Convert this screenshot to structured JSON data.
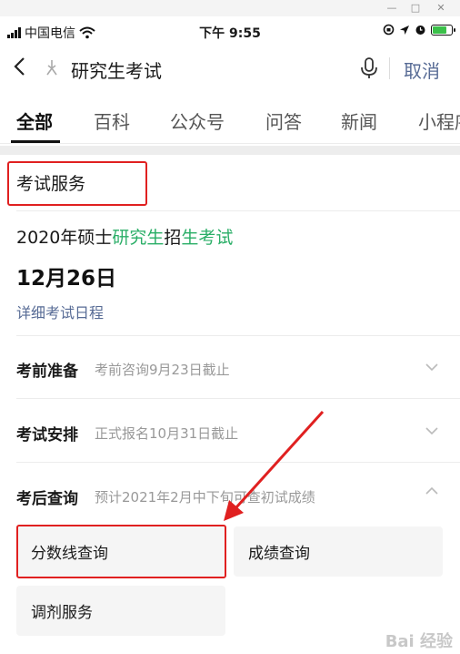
{
  "status_bar": {
    "carrier": "中国电信",
    "time": "下午 9:55"
  },
  "search": {
    "query": "研究生考试",
    "cancel_label": "取消"
  },
  "tabs": [
    {
      "label": "全部",
      "active": true
    },
    {
      "label": "百科",
      "active": false
    },
    {
      "label": "公众号",
      "active": false
    },
    {
      "label": "问答",
      "active": false
    },
    {
      "label": "新闻",
      "active": false
    },
    {
      "label": "小程序",
      "active": false
    }
  ],
  "card": {
    "title": "考试服务",
    "exam_title_parts": [
      "2020年硕士",
      "研究生",
      "招",
      "生考试"
    ],
    "exam_date": "12月26日",
    "schedule_link": "详细考试日程",
    "rows": [
      {
        "label": "考前准备",
        "sub": "考前咨询9月23日截止",
        "expanded": false
      },
      {
        "label": "考试安排",
        "sub": "正式报名10月31日截止",
        "expanded": false
      },
      {
        "label": "考后查询",
        "sub": "预计2021年2月中下旬可查初试成绩",
        "expanded": true
      }
    ],
    "buttons": [
      {
        "label": "分数线查询"
      },
      {
        "label": "成绩查询"
      },
      {
        "label": "调剂服务"
      }
    ]
  },
  "watermark": "Bai 经验",
  "colors": {
    "highlight_green": "#2aae67",
    "link_blue": "#576b95",
    "annotation_red": "#e02020"
  }
}
